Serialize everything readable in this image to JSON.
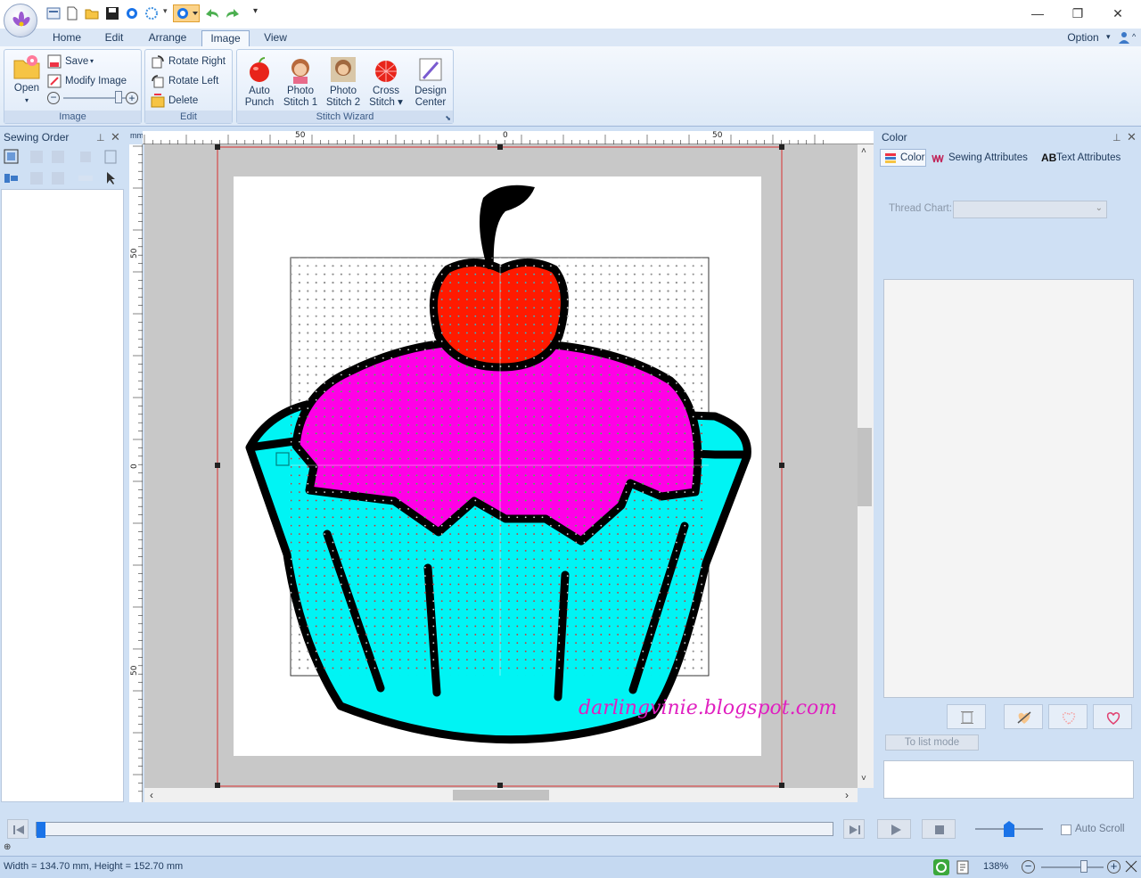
{
  "quick_access": {
    "icons": [
      "app-orb-icon",
      "design-icon",
      "new-icon",
      "open-folder-icon",
      "save-icon",
      "circle-icon",
      "snowflake-icon",
      "select-icon",
      "undo-icon",
      "redo-icon",
      "customize-icon"
    ]
  },
  "window_controls": {
    "minimize": "—",
    "restore": "❐",
    "close": "✕"
  },
  "tabs": [
    {
      "label": "Home"
    },
    {
      "label": "Edit"
    },
    {
      "label": "Arrange"
    },
    {
      "label": "Image"
    },
    {
      "label": "View"
    }
  ],
  "active_tab": "Image",
  "option_menu": {
    "label": "Option"
  },
  "ribbon": {
    "image_group": {
      "label": "Image",
      "open": "Open",
      "save": "Save",
      "modify_image": "Modify Image",
      "zoom_minus": "−",
      "zoom_plus": "+"
    },
    "edit_group": {
      "label": "Edit",
      "rotate_right": "Rotate Right",
      "rotate_left": "Rotate Left",
      "delete": "Delete"
    },
    "stitch_wizard_group": {
      "label": "Stitch Wizard",
      "auto_punch": [
        "Auto",
        "Punch"
      ],
      "photo_stitch_1": [
        "Photo",
        "Stitch 1"
      ],
      "photo_stitch_2": [
        "Photo",
        "Stitch 2"
      ],
      "cross_stitch": [
        "Cross",
        "Stitch"
      ],
      "design_center": [
        "Design",
        "Center"
      ]
    }
  },
  "sewing_order": {
    "title": "Sewing Order"
  },
  "ruler": {
    "unit": "mm",
    "top_labels": [
      "50",
      "0",
      "50"
    ],
    "left_labels": [
      "50",
      "0",
      "50"
    ]
  },
  "canvas": {
    "watermark": "darlingvinie.blogspot.com",
    "colors": {
      "cup": "#00f4f4",
      "frosting": "#ff00e6",
      "cherry": "#ff1a00",
      "outline": "#000000"
    }
  },
  "color_panel": {
    "title": "Color",
    "tabs": [
      "Color",
      "Sewing Attributes",
      "Text Attributes"
    ],
    "text_attr_prefix": "AB",
    "thread_chart_label": "Thread Chart:",
    "thread_chart_value": "",
    "list_mode_button": "To list mode"
  },
  "playback": {
    "progress": 0.0,
    "auto_scroll": "Auto Scroll",
    "auto_scroll_checked": false
  },
  "status": {
    "dimensions": "Width  = 134.70 mm, Height = 152.70 mm",
    "zoom": "138%"
  }
}
